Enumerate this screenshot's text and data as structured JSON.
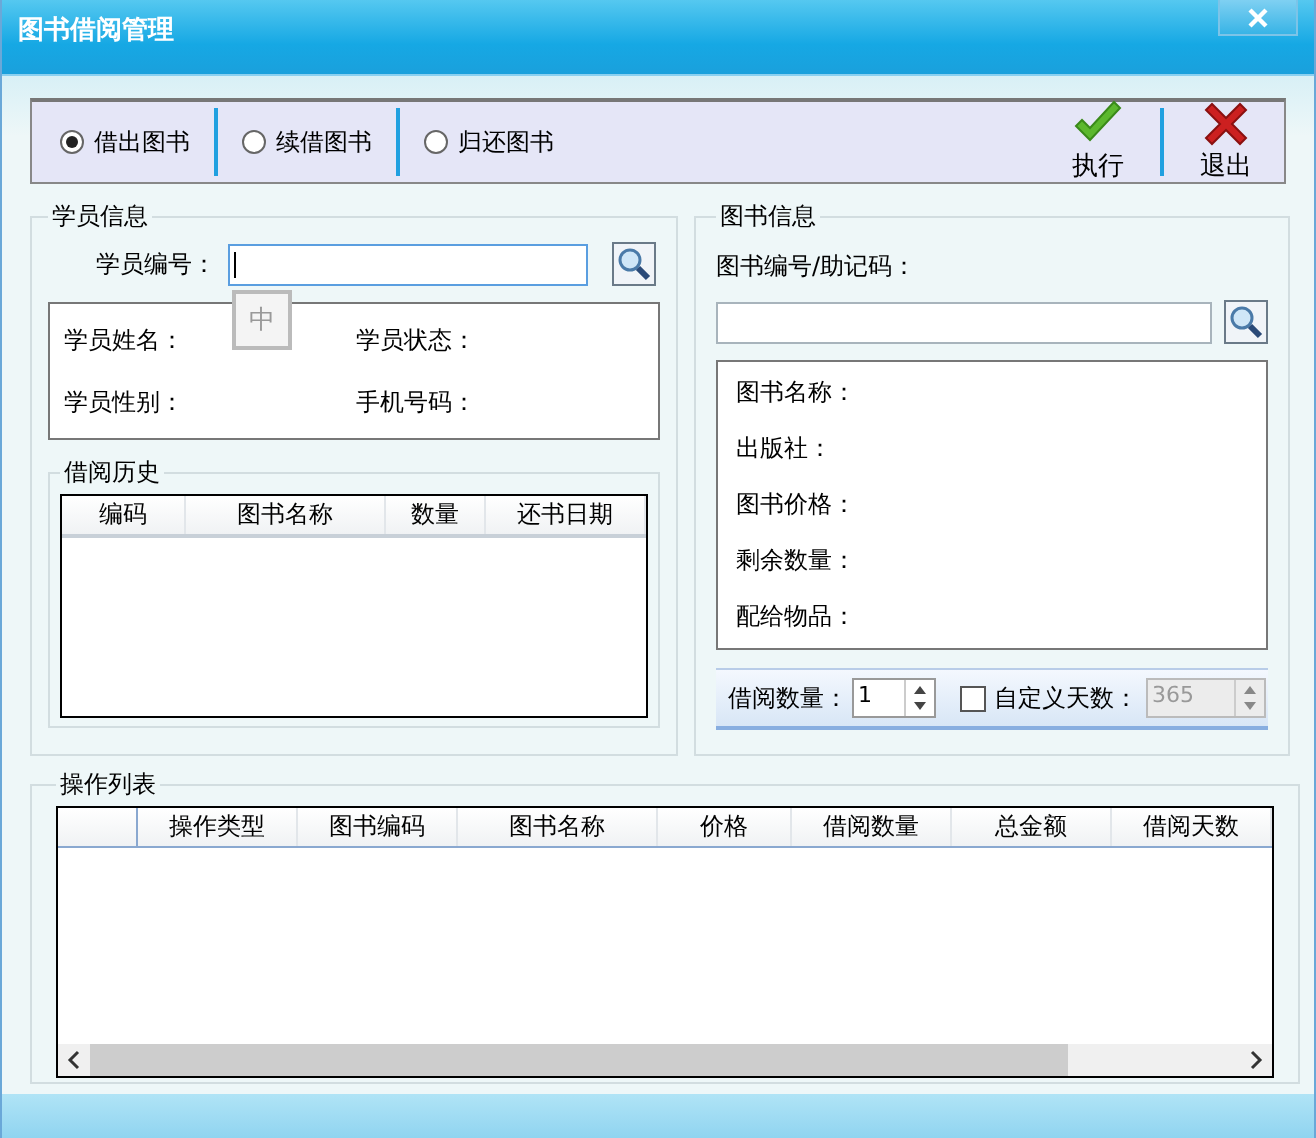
{
  "window": {
    "title": "图书借阅管理"
  },
  "modes": [
    {
      "label": "借出图书",
      "selected": true
    },
    {
      "label": "续借图书",
      "selected": false
    },
    {
      "label": "归还图书",
      "selected": false
    }
  ],
  "actions": [
    {
      "label": "执行",
      "kind": "execute"
    },
    {
      "label": "退出",
      "kind": "exit"
    }
  ],
  "student": {
    "title": "学员信息",
    "id_label": "学员编号：",
    "ime_indicator": "中",
    "fields": [
      {
        "label": "学员姓名："
      },
      {
        "label": "学员状态："
      },
      {
        "label": "学员性别："
      },
      {
        "label": "手机号码："
      }
    ]
  },
  "history": {
    "title": "借阅历史",
    "columns": [
      "编码",
      "图书名称",
      "数量",
      "还书日期"
    ]
  },
  "book": {
    "title": "图书信息",
    "search_label": "图书编号/助记码：",
    "fields": [
      {
        "label": "图书名称："
      },
      {
        "label": "出版社："
      },
      {
        "label": "图书价格："
      },
      {
        "label": "剩余数量："
      },
      {
        "label": "配给物品："
      }
    ],
    "quantity_label": "借阅数量：",
    "quantity_value": "1",
    "custom_days": {
      "label": "自定义天数：",
      "checked": false,
      "disabled": true,
      "value": "365"
    }
  },
  "operations": {
    "title": "操作列表",
    "columns": [
      "",
      "操作类型",
      "图书编码",
      "图书名称",
      "价格",
      "借阅数量",
      "总金额",
      "借阅天数"
    ]
  }
}
